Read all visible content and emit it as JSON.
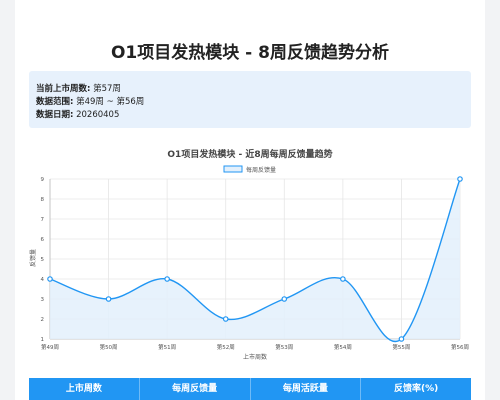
{
  "page": {
    "title": "O1项目发热模块 - 8周反馈趋势分析"
  },
  "info": {
    "current_week_label": "当前上市周数:",
    "current_week_value": "第57周",
    "range_label": "数据范围:",
    "range_value": "第49周 ~ 第56周",
    "date_label": "数据日期:",
    "date_value": "20260405"
  },
  "colors": {
    "accent": "#2196f3",
    "fill": "#e3f0fc",
    "info_bg": "#e7f1fc"
  },
  "chart_data": {
    "type": "line",
    "title": "O1项目发热模块 - 近8周每周反馈量趋势",
    "xlabel": "上市周数",
    "ylabel": "反馈量",
    "categories": [
      "第49周",
      "第50周",
      "第51周",
      "第52周",
      "第53周",
      "第54周",
      "第55周",
      "第56周"
    ],
    "series": [
      {
        "name": "每周反馈量",
        "values": [
          4,
          3,
          4,
          2,
          3,
          4,
          1,
          9
        ]
      }
    ],
    "ylim": [
      1,
      9
    ],
    "yticks": [
      "1",
      "2",
      "3",
      "4",
      "5",
      "6",
      "7",
      "8",
      "9"
    ],
    "grid": true,
    "legend": "top-center",
    "smooth": true,
    "area_fill": true
  },
  "table": {
    "headers": [
      "上市周数",
      "每周反馈量",
      "每周活跃量",
      "反馈率(%)"
    ]
  }
}
